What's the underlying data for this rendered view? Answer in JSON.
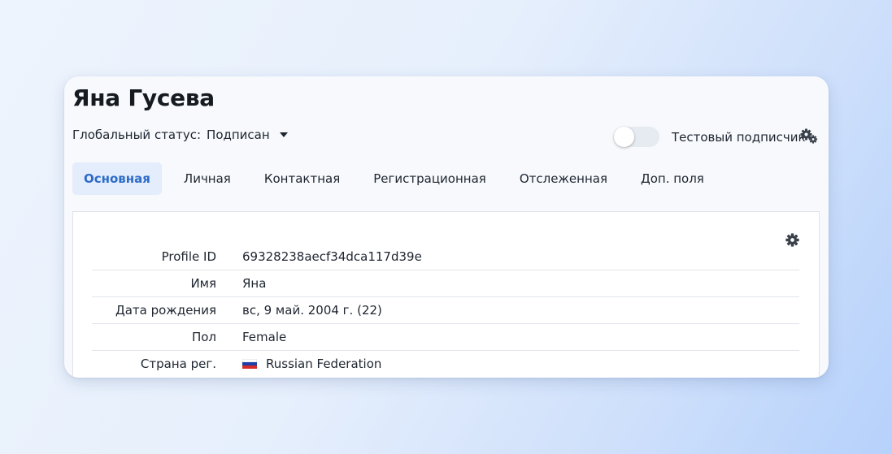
{
  "profile": {
    "name": "Яна Гусева",
    "status_label": "Глобальный статус:",
    "status_value": "Подписан",
    "test_subscriber_label": "Тестовый подписчик",
    "test_subscriber_enabled": false
  },
  "tabs": [
    {
      "label": "Основная",
      "active": true
    },
    {
      "label": "Личная",
      "active": false
    },
    {
      "label": "Контактная",
      "active": false
    },
    {
      "label": "Регистрационная",
      "active": false
    },
    {
      "label": "Отслеженная",
      "active": false
    },
    {
      "label": "Доп. поля",
      "active": false
    }
  ],
  "fields": [
    {
      "label": "Profile ID",
      "value": "69328238aecf34dca117d39e"
    },
    {
      "label": "Имя",
      "value": "Яна"
    },
    {
      "label": "Дата рождения",
      "value": "вс, 9 май. 2004 г. (22)"
    },
    {
      "label": "Пол",
      "value": "Female"
    },
    {
      "label": "Страна рег.",
      "value": "Russian Federation",
      "flag": "russia-flag"
    }
  ],
  "icons": {
    "status_dropdown": "caret-down-icon",
    "settings": "gears-icon",
    "panel_settings": "gear-icon"
  },
  "colors": {
    "accent": "#2d6bc9",
    "active_tab_bg": "#e3edfb",
    "flag_white": "#ffffff",
    "flag_blue": "#1c3fa8",
    "flag_red": "#d62b2b"
  }
}
